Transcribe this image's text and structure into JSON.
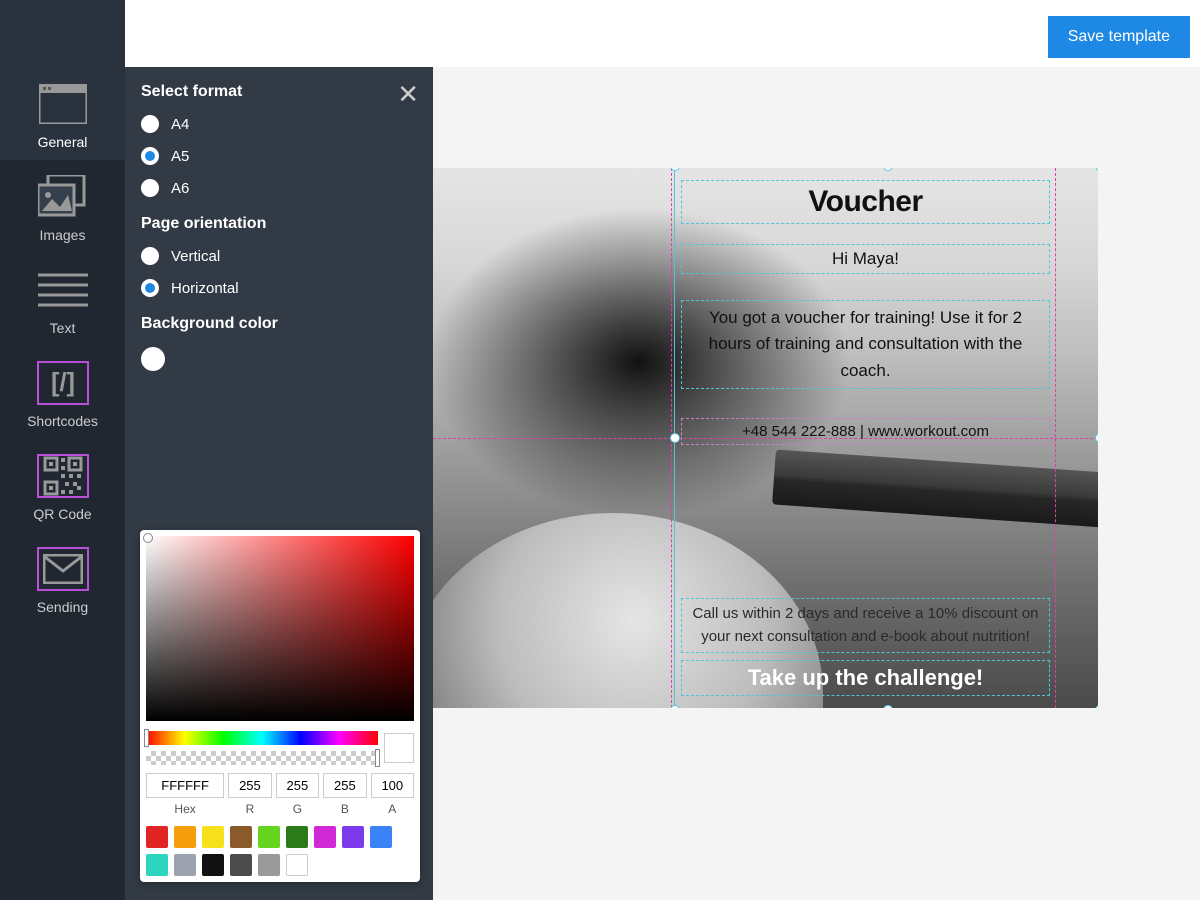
{
  "topbar": {
    "save": "Save template"
  },
  "rail": {
    "items": [
      {
        "key": "general",
        "label": "General"
      },
      {
        "key": "images",
        "label": "Images"
      },
      {
        "key": "text",
        "label": "Text"
      },
      {
        "key": "shortcodes",
        "label": "Shortcodes"
      },
      {
        "key": "qrcode",
        "label": "QR Code"
      },
      {
        "key": "sending",
        "label": "Sending"
      }
    ]
  },
  "panel": {
    "format_title": "Select format",
    "formats": {
      "a4": "A4",
      "a5": "A5",
      "a6": "A6",
      "selected": "a5"
    },
    "orientation_title": "Page orientation",
    "orientations": {
      "vertical": "Vertical",
      "horizontal": "Horizontal",
      "selected": "horizontal"
    },
    "bg_title": "Background color",
    "bg_value": "#FFFFFF"
  },
  "colorpicker": {
    "hex": "FFFFFF",
    "r": "255",
    "g": "255",
    "b": "255",
    "a": "100",
    "labels": {
      "hex": "Hex",
      "r": "R",
      "g": "G",
      "b": "B",
      "a": "A"
    },
    "presets_row1": [
      "#e02424",
      "#f59e0b",
      "#f7e11d",
      "#8b5a2b",
      "#65d41f",
      "#2d7a1b",
      "#d229d6",
      "#7c3aed"
    ],
    "presets_row2": [
      "#3b82f6",
      "#2dd4bf",
      "#9ca3af",
      "#111111",
      "#4b4b4b",
      "#9a9a9a",
      "#ffffff"
    ]
  },
  "voucher": {
    "title": "Voucher",
    "greeting": "Hi Maya!",
    "body": "You got a voucher for training! Use it for 2 hours of training and consultation with the coach.",
    "contact": "+48 544 222-888 | www.workout.com",
    "promo": "Call us within 2 days and receive a 10% discount on your next consultation and e-book about nutrition!",
    "cta": "Take up the challenge!"
  }
}
